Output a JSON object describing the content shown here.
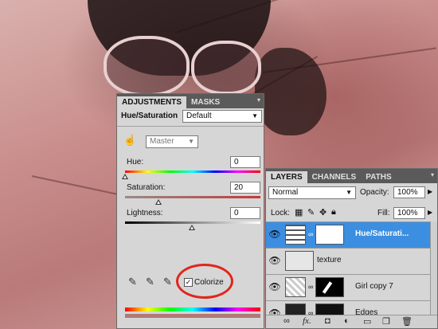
{
  "adjustments": {
    "tabs": [
      "ADJUSTMENTS",
      "MASKS"
    ],
    "title": "Hue/Saturation",
    "preset": "Default",
    "channel": "Master",
    "hue_label": "Hue:",
    "hue_value": "0",
    "saturation_label": "Saturation:",
    "saturation_value": "20",
    "lightness_label": "Lightness:",
    "lightness_value": "0",
    "colorize_label": "Colorize",
    "colorize_checked": "✓"
  },
  "layers": {
    "tabs": [
      "LAYERS",
      "CHANNELS",
      "PATHS"
    ],
    "blend_mode": "Normal",
    "opacity_label": "Opacity:",
    "opacity_value": "100%",
    "lock_label": "Lock:",
    "fill_label": "Fill:",
    "fill_value": "100%",
    "items": [
      {
        "name": "Hue/Saturati...",
        "selected": true
      },
      {
        "name": "texture",
        "selected": false
      },
      {
        "name": "Girl copy 7",
        "selected": false
      },
      {
        "name": "Edges",
        "selected": false
      }
    ]
  },
  "colors": {
    "selection": "#3b8ee0",
    "highlight_circle": "#e0261c"
  }
}
